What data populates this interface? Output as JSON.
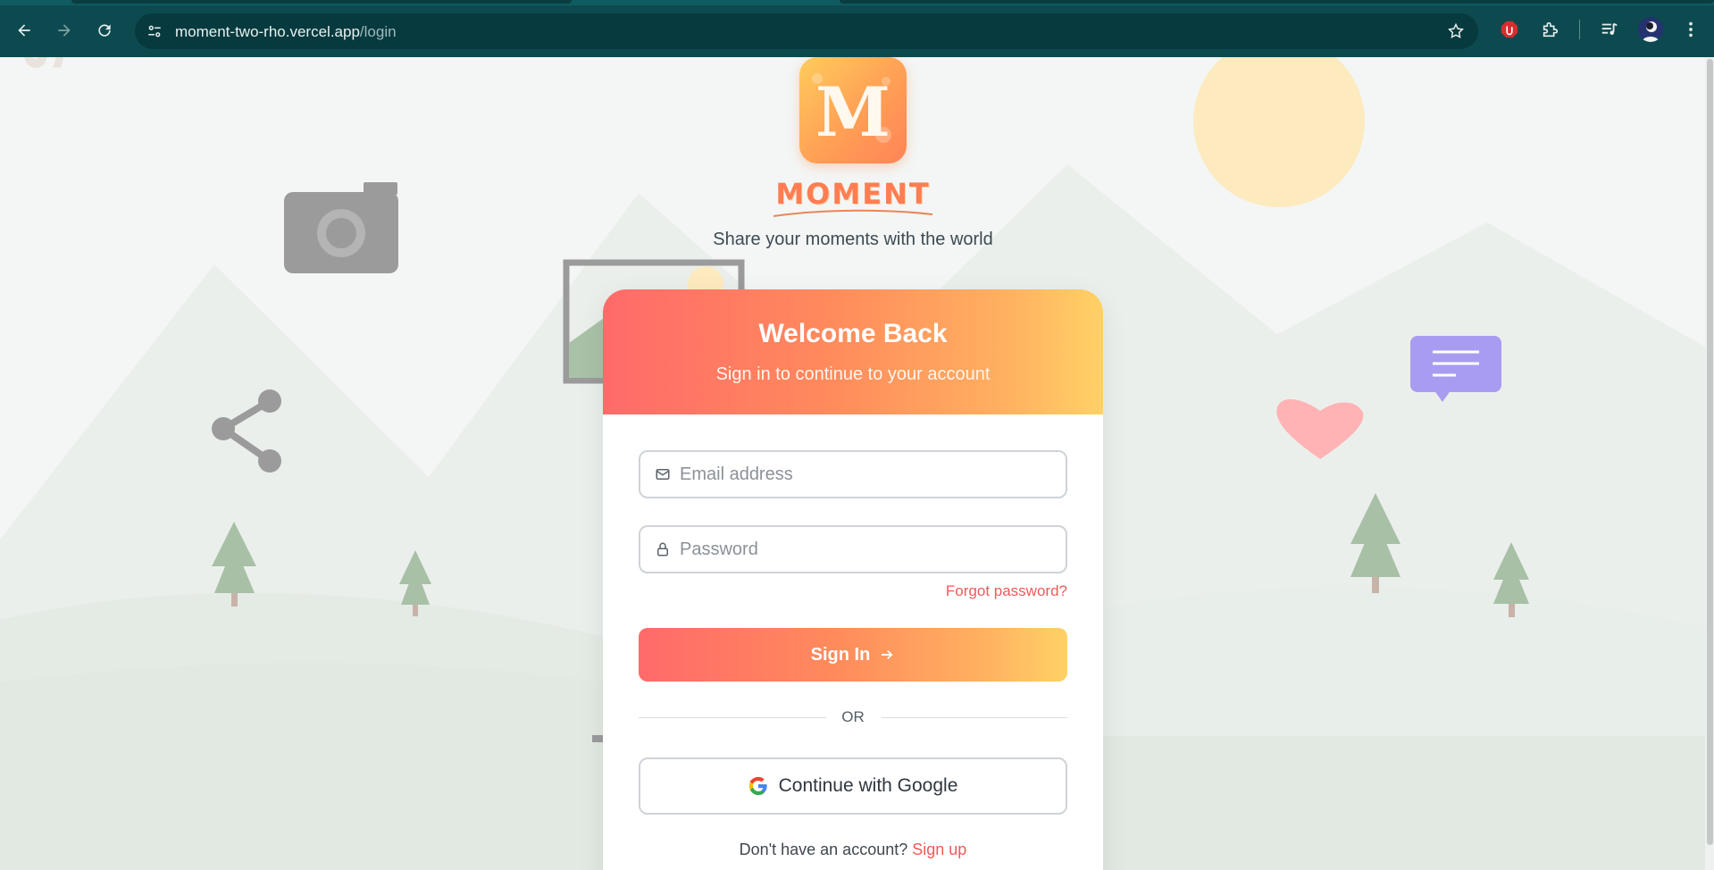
{
  "browser": {
    "url_host": "moment-two-rho.vercel.app",
    "url_path": "/login",
    "icons": [
      "back-arrow-icon",
      "forward-arrow-icon",
      "reload-icon",
      "site-info-icon",
      "bookmark-star-icon",
      "adblock-extension-icon",
      "extensions-puzzle-icon",
      "media-control-icon",
      "profile-avatar",
      "menu-kebab-icon"
    ]
  },
  "brand": {
    "logo_letter": "M",
    "name": "MOMENT",
    "tagline": "Share your moments with the world"
  },
  "login": {
    "title": "Welcome Back",
    "subtitle": "Sign in to continue to your account",
    "email_placeholder": "Email address",
    "password_placeholder": "Password",
    "forgot_label": "Forgot password?",
    "signin_label": "Sign In",
    "or_label": "OR",
    "google_label": "Continue with Google",
    "no_account_text": "Don't have an account?",
    "signup_label": "Sign up"
  },
  "colors": {
    "gradient_start": "#ff6a6a",
    "gradient_end": "#ffd166",
    "accent_link": "#f05a5a",
    "chrome_bg": "#0d4a4f"
  }
}
